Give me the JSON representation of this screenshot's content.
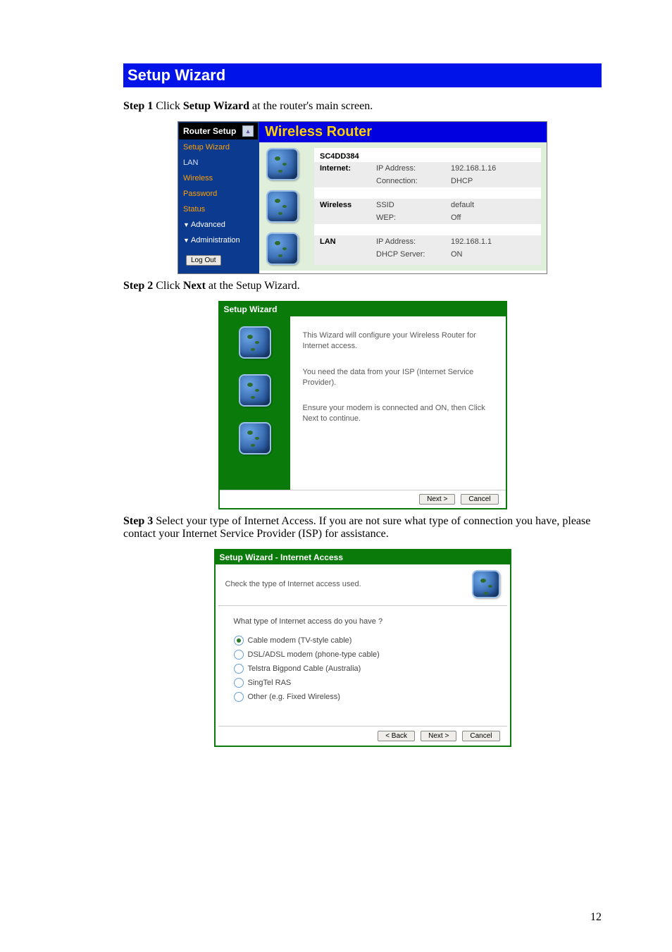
{
  "section_title": "Setup Wizard",
  "step1": {
    "prefix": "Step 1",
    "mid": " Click ",
    "bold": "Setup Wizard",
    "suffix": " at the router's main screen."
  },
  "step2": {
    "prefix": "Step 2",
    "mid": " Click ",
    "bold": "Next",
    "suffix": " at the Setup Wizard."
  },
  "step3": {
    "prefix": "Step 3",
    "text": " Select your type of Internet Access. If you are not sure what type of connection you have, please contact your Internet Service Provider (ISP) for assistance."
  },
  "router": {
    "side_title": "Router Setup",
    "nav": {
      "setup": "Setup Wizard",
      "lan": "LAN",
      "wireless": "Wireless",
      "password": "Password",
      "status": "Status",
      "advanced": "Advanced",
      "admin": "Administration"
    },
    "logout": "Log Out",
    "main_title": "Wireless Router",
    "device": "SC4DD384",
    "rows": {
      "internet": {
        "h": "Internet:",
        "k1": "IP Address:",
        "v1": "192.168.1.16",
        "k2": "Connection:",
        "v2": "DHCP"
      },
      "wireless": {
        "h": "Wireless",
        "k1": "SSID",
        "v1": "default",
        "k2": "WEP:",
        "v2": "Off"
      },
      "lan": {
        "h": "LAN",
        "k1": "IP Address:",
        "v1": "192.168.1.1",
        "k2": "DHCP Server:",
        "v2": "ON"
      }
    }
  },
  "wiz": {
    "head": "Setup Wizard",
    "p1": "This Wizard will configure your Wireless Router for Internet access.",
    "p2": "You need the data from your ISP (Internet Service Provider).",
    "p3": "Ensure your modem is connected and ON, then Click Next to continue.",
    "next": "Next >",
    "cancel": "Cancel"
  },
  "acc": {
    "head": "Setup Wizard - Internet Access",
    "check": "Check the type of Internet access used.",
    "q": "What type of Internet access do you have ?",
    "o1": "Cable modem (TV-style cable)",
    "o2": "DSL/ADSL modem (phone-type cable)",
    "o3": "Telstra Bigpond Cable (Australia)",
    "o4": "SingTel RAS",
    "o5": "Other (e.g. Fixed Wireless)",
    "back": "< Back",
    "next": "Next >",
    "cancel": "Cancel"
  },
  "page_number": "12"
}
